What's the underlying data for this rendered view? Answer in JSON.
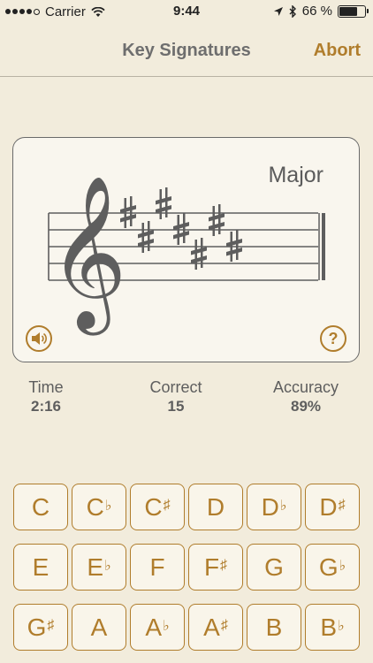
{
  "status_bar": {
    "carrier": "Carrier",
    "time": "9:44",
    "battery": "66 %",
    "signal_bars": 4,
    "battery_level": 0.66,
    "icons": [
      "wifi-icon",
      "location-arrow-icon",
      "bluetooth-icon",
      "battery-icon"
    ]
  },
  "nav": {
    "title": "Key Signatures",
    "abort_label": "Abort"
  },
  "card": {
    "mode": "Major",
    "clef": "treble",
    "accidental_type": "sharp",
    "accidental_count": 7,
    "sound_icon": "speaker-icon",
    "help_label": "?"
  },
  "stats": {
    "time_label": "Time",
    "time_value": "2:16",
    "correct_label": "Correct",
    "correct_value": "15",
    "accuracy_label": "Accuracy",
    "accuracy_value": "89%"
  },
  "keys": [
    {
      "letter": "C",
      "accidental": ""
    },
    {
      "letter": "C",
      "accidental": "♭"
    },
    {
      "letter": "C",
      "accidental": "♯"
    },
    {
      "letter": "D",
      "accidental": ""
    },
    {
      "letter": "D",
      "accidental": "♭"
    },
    {
      "letter": "D",
      "accidental": "♯"
    },
    {
      "letter": "E",
      "accidental": ""
    },
    {
      "letter": "E",
      "accidental": "♭"
    },
    {
      "letter": "F",
      "accidental": ""
    },
    {
      "letter": "F",
      "accidental": "♯"
    },
    {
      "letter": "G",
      "accidental": ""
    },
    {
      "letter": "G",
      "accidental": "♭"
    },
    {
      "letter": "G",
      "accidental": "♯"
    },
    {
      "letter": "A",
      "accidental": ""
    },
    {
      "letter": "A",
      "accidental": "♭"
    },
    {
      "letter": "A",
      "accidental": "♯"
    },
    {
      "letter": "B",
      "accidental": ""
    },
    {
      "letter": "B",
      "accidental": "♭"
    }
  ],
  "colors": {
    "accent": "#b07d2c",
    "background": "#f2ecdc",
    "card": "#f9f6ee",
    "text": "#5e5e5e"
  }
}
